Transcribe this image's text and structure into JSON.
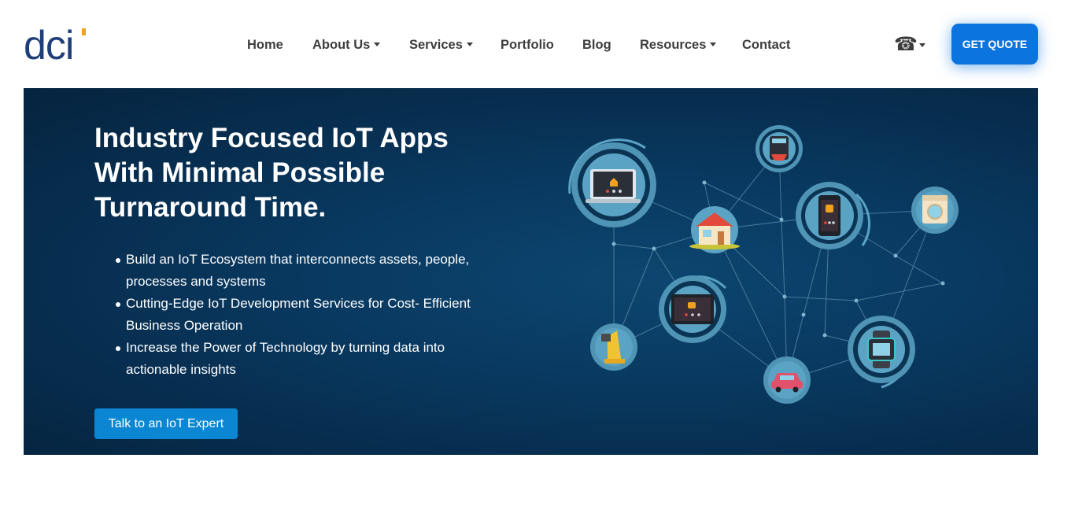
{
  "brand": {
    "logo_text": "dci",
    "accent": "#f0a21f",
    "logo_color": "#1f3f7a"
  },
  "nav": {
    "items": [
      {
        "label": "Home",
        "dropdown": false
      },
      {
        "label": "About Us",
        "dropdown": true
      },
      {
        "label": "Services",
        "dropdown": true
      },
      {
        "label": "Portfolio",
        "dropdown": false
      },
      {
        "label": "Blog",
        "dropdown": false
      },
      {
        "label": "Resources",
        "dropdown": true
      },
      {
        "label": "Contact",
        "dropdown": false
      }
    ],
    "phone_icon": "☎",
    "cta_label": "GET QUOTE"
  },
  "hero": {
    "title_lines": [
      "Industry Focused IoT Apps",
      "With Minimal Possible",
      "Turnaround Time."
    ],
    "bullets": [
      "Build an IoT Ecosystem that interconnects assets, people, processes and systems",
      "Cutting-Edge IoT Development Services for Cost- Efficient Business Operation",
      "Increase the Power of Technology by turning data into actionable insights"
    ],
    "cta_label": "Talk to an IoT Expert"
  },
  "colors": {
    "hero_bg": "#072d4e",
    "cta_primary": "#0b74de",
    "cta_secondary": "#0a86d2",
    "node_ring": "#5aa3c4"
  },
  "illustration": {
    "icons": [
      "laptop-icon",
      "house-icon",
      "coffee-machine-icon",
      "smartphone-icon",
      "washing-machine-icon",
      "tablet-icon",
      "lamp-icon",
      "car-icon",
      "smartwatch-icon"
    ]
  }
}
